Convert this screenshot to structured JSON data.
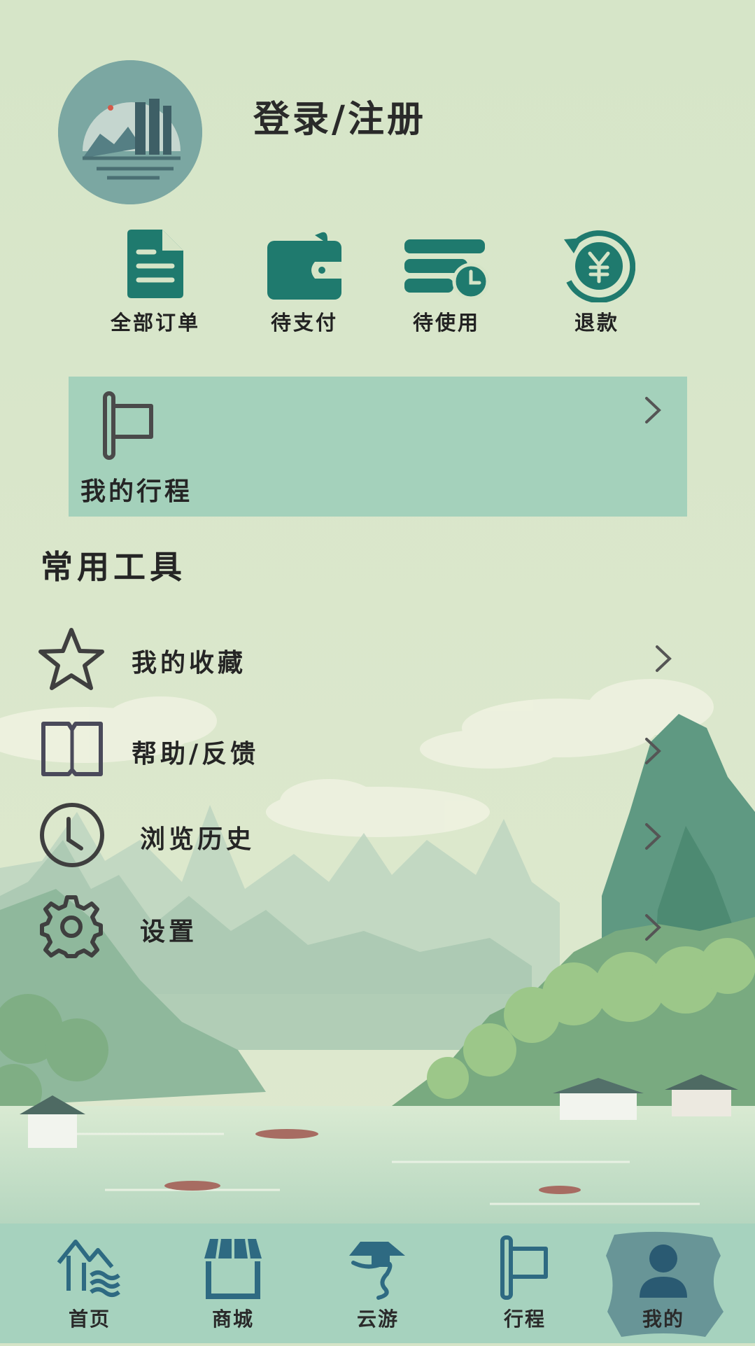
{
  "header": {
    "login_label": "登录/注册"
  },
  "orders": [
    {
      "label": "全部订单",
      "icon": "document-icon"
    },
    {
      "label": "待支付",
      "icon": "wallet-icon"
    },
    {
      "label": "待使用",
      "icon": "ticket-clock-icon"
    },
    {
      "label": "退款",
      "icon": "refund-yen-icon"
    }
  ],
  "trip_card": {
    "label": "我的行程",
    "icon": "flag-icon"
  },
  "tools": {
    "title": "常用工具",
    "items": [
      {
        "label": "我的收藏",
        "icon": "star-icon"
      },
      {
        "label": "帮助/反馈",
        "icon": "book-icon"
      },
      {
        "label": "浏览历史",
        "icon": "clock-icon"
      },
      {
        "label": "设置",
        "icon": "gear-icon"
      }
    ]
  },
  "bottom_nav": [
    {
      "label": "首页",
      "icon": "home-waves-icon",
      "active": false
    },
    {
      "label": "商城",
      "icon": "store-icon",
      "active": false
    },
    {
      "label": "云游",
      "icon": "cloud-travel-icon",
      "active": false
    },
    {
      "label": "行程",
      "icon": "flag-icon",
      "active": false
    },
    {
      "label": "我的",
      "icon": "user-icon",
      "active": true
    }
  ],
  "colors": {
    "background": "#d5e4c7",
    "accent_teal": "#1f7a6e",
    "card": "#a4d1bb",
    "nav_bar": "#a6d2be",
    "nav_icon": "#2e6a82"
  }
}
